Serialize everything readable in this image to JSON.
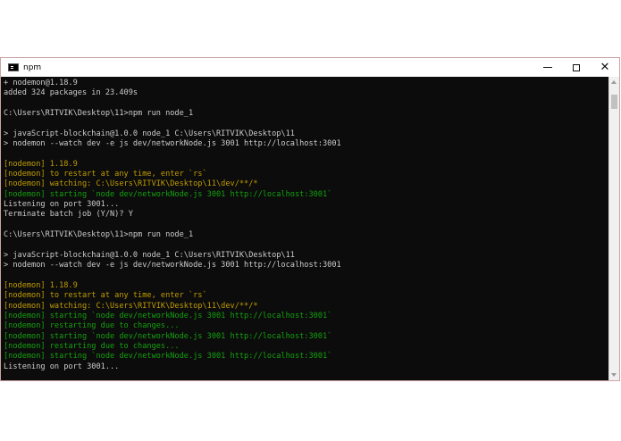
{
  "window": {
    "title": "npm",
    "icon": "console-icon"
  },
  "console": {
    "lines": [
      {
        "text": "+ nodemon@1.18.9",
        "color": "white"
      },
      {
        "text": "added 324 packages in 23.409s",
        "color": "white"
      },
      {
        "text": "",
        "color": "white"
      },
      {
        "text": "C:\\Users\\RITVIK\\Desktop\\11>npm run node_1",
        "color": "white"
      },
      {
        "text": "",
        "color": "white"
      },
      {
        "text": "> javaScript-blockchain@1.0.0 node_1 C:\\Users\\RITVIK\\Desktop\\11",
        "color": "white"
      },
      {
        "text": "> nodemon --watch dev -e js dev/networkNode.js 3001 http://localhost:3001",
        "color": "white"
      },
      {
        "text": "",
        "color": "white"
      },
      {
        "text": "[nodemon] 1.18.9",
        "color": "yellow"
      },
      {
        "text": "[nodemon] to restart at any time, enter `rs`",
        "color": "yellow"
      },
      {
        "text": "[nodemon] watching: C:\\Users\\RITVIK\\Desktop\\11\\dev/**/*",
        "color": "yellow"
      },
      {
        "text": "[nodemon] starting `node dev/networkNode.js 3001 http://localhost:3001`",
        "color": "green"
      },
      {
        "text": "Listening on port 3001...",
        "color": "white"
      },
      {
        "text": "Terminate batch job (Y/N)? Y",
        "color": "white"
      },
      {
        "text": "",
        "color": "white"
      },
      {
        "text": "C:\\Users\\RITVIK\\Desktop\\11>npm run node_1",
        "color": "white"
      },
      {
        "text": "",
        "color": "white"
      },
      {
        "text": "> javaScript-blockchain@1.0.0 node_1 C:\\Users\\RITVIK\\Desktop\\11",
        "color": "white"
      },
      {
        "text": "> nodemon --watch dev -e js dev/networkNode.js 3001 http://localhost:3001",
        "color": "white"
      },
      {
        "text": "",
        "color": "white"
      },
      {
        "text": "[nodemon] 1.18.9",
        "color": "yellow"
      },
      {
        "text": "[nodemon] to restart at any time, enter `rs`",
        "color": "yellow"
      },
      {
        "text": "[nodemon] watching: C:\\Users\\RITVIK\\Desktop\\11\\dev/**/*",
        "color": "yellow"
      },
      {
        "text": "[nodemon] starting `node dev/networkNode.js 3001 http://localhost:3001`",
        "color": "green"
      },
      {
        "text": "[nodemon] restarting due to changes...",
        "color": "green"
      },
      {
        "text": "[nodemon] starting `node dev/networkNode.js 3001 http://localhost:3001`",
        "color": "green"
      },
      {
        "text": "[nodemon] restarting due to changes...",
        "color": "green"
      },
      {
        "text": "[nodemon] starting `node dev/networkNode.js 3001 http://localhost:3001`",
        "color": "green"
      },
      {
        "text": "Listening on port 3001...",
        "color": "white"
      }
    ]
  },
  "colors": {
    "background": "#0c0c0c",
    "white": "#cccccc",
    "yellow": "#c19c00",
    "green": "#13a10e"
  },
  "controls": {
    "minimize_icon": "minimize-icon",
    "maximize_icon": "maximize-icon",
    "close_icon": "close-icon"
  }
}
